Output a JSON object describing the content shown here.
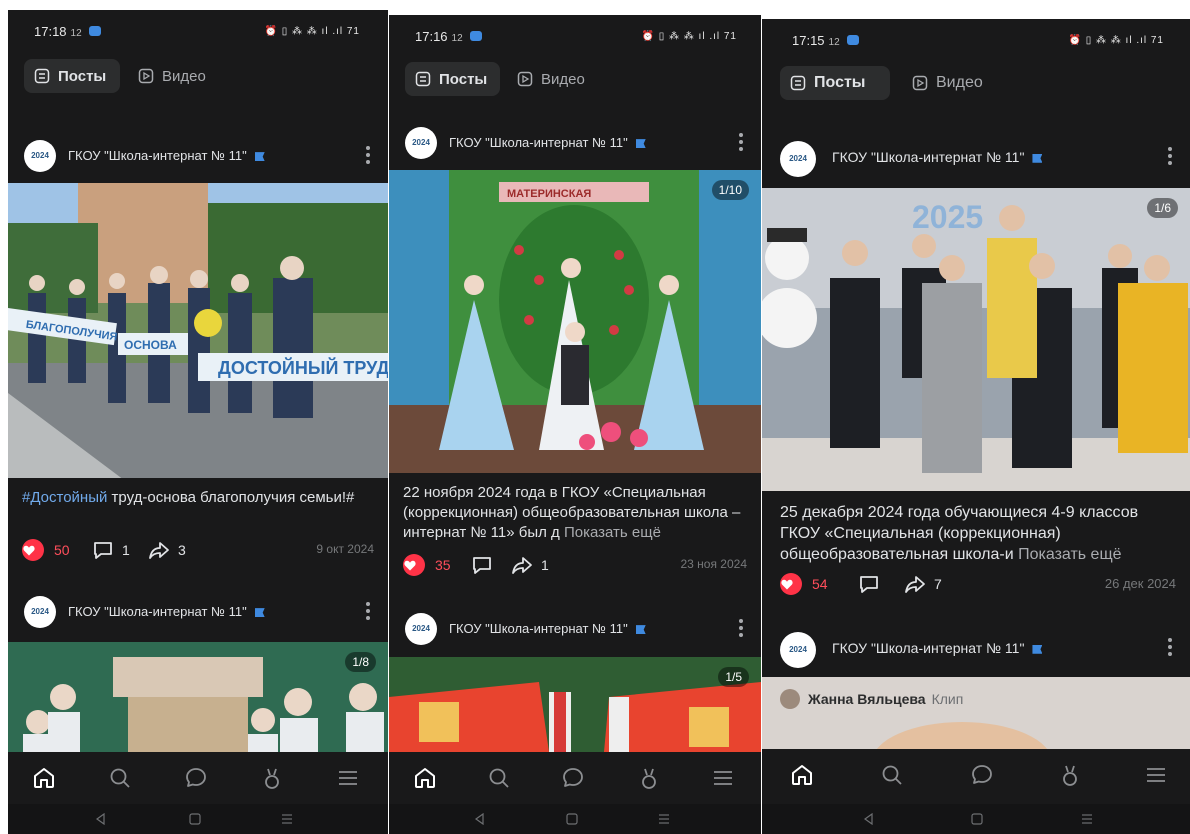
{
  "screens": [
    {
      "status": {
        "time": "17:18",
        "sub": "12",
        "icons": "⏰ ▯ ⁂ ⁂ ıl .ıl 71"
      },
      "tabs": {
        "posts": "Посты",
        "video": "Видео"
      },
      "posts": [
        {
          "author": "ГКОУ \"Школа-интернат № 11\"",
          "hashtag": "#Достойный",
          "text": " труд-основа благополучия семьи!#",
          "likes": "50",
          "comments": "1",
          "shares": "3",
          "date": "9 окт 2024"
        },
        {
          "author": "ГКОУ \"Школа-интернат № 11\"",
          "counter": "1/8"
        }
      ]
    },
    {
      "status": {
        "time": "17:16",
        "sub": "12",
        "icons": "⏰ ▯ ⁂ ⁂ ıl .ıl 71"
      },
      "tabs": {
        "posts": "Посты",
        "video": "Видео"
      },
      "posts": [
        {
          "author": "ГКОУ \"Школа-интернат № 11\"",
          "counter": "1/10",
          "text": "22 ноября 2024 года в ГКОУ «Специальная (коррекционная) общеобразовательная школа – интернат № 11» был д",
          "more": "Показать ещё",
          "likes": "35",
          "comments": "",
          "shares": "1",
          "date": "23 ноя 2024"
        },
        {
          "author": "ГКОУ \"Школа-интернат № 11\"",
          "counter": "1/5"
        }
      ]
    },
    {
      "status": {
        "time": "17:15",
        "sub": "12",
        "icons": "⏰ ▯ ⁂ ⁂ ıl .ıl 71"
      },
      "tabs": {
        "posts": "Посты",
        "video": "Видео"
      },
      "posts": [
        {
          "author": "ГКОУ \"Школа-интернат № 11\"",
          "counter": "1/6",
          "text": "25 декабря 2024 года обучающиеся 4-9 классов ГКОУ «Специальная (коррекционная) общеобразовательная школа-и",
          "more": "Показать ещё",
          "likes": "54",
          "comments": "",
          "shares": "7",
          "date": "26 дек 2024"
        },
        {
          "author": "ГКОУ \"Школа-интернат № 11\"",
          "clip_author": "Жанна Вяльцева",
          "clip_label": "Клип"
        }
      ]
    }
  ],
  "avatar_text": "2024",
  "colors": {
    "bg": "#19191a",
    "like": "#ff3347",
    "accent": "#3f8ae0",
    "hashtag": "#71aaeb"
  }
}
